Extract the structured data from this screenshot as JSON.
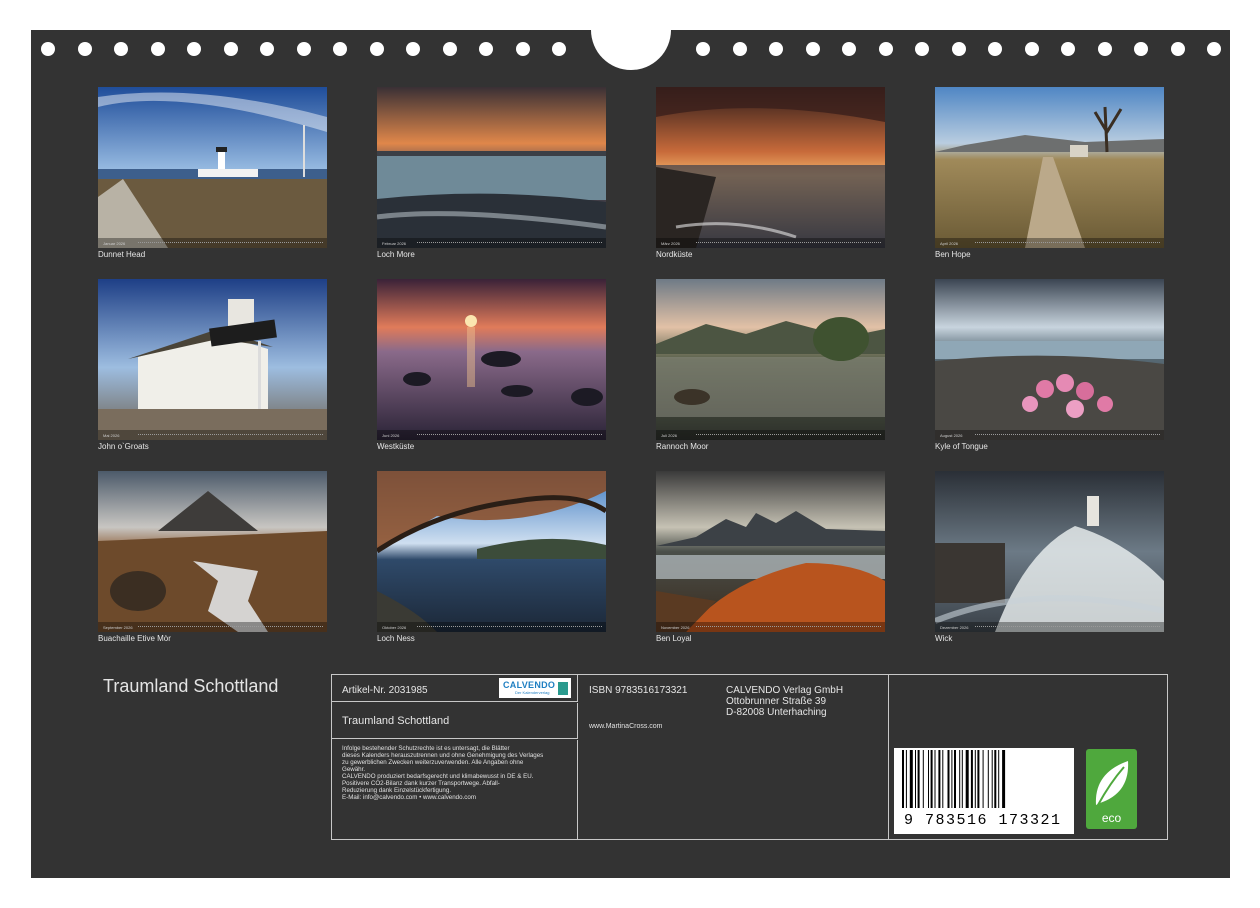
{
  "calendar_title": "Traumland Schottland",
  "months": [
    {
      "month": "Januar 2026",
      "caption": "Dunnet Head"
    },
    {
      "month": "Februar 2026",
      "caption": "Loch More"
    },
    {
      "month": "März 2026",
      "caption": "Nordküste"
    },
    {
      "month": "April 2026",
      "caption": "Ben Hope"
    },
    {
      "month": "Mai 2026",
      "caption": "John o`Groats"
    },
    {
      "month": "Juni 2026",
      "caption": "Westküste"
    },
    {
      "month": "Juli 2026",
      "caption": "Rannoch Moor"
    },
    {
      "month": "August 2026",
      "caption": "Kyle of Tongue"
    },
    {
      "month": "September 2026",
      "caption": "Buachaille Etive Mòr"
    },
    {
      "month": "Oktober 2026",
      "caption": "Loch Ness"
    },
    {
      "month": "November 2026",
      "caption": "Ben Loyal"
    },
    {
      "month": "Dezember 2026",
      "caption": "Wick"
    }
  ],
  "info": {
    "article": "Artikel-Nr. 2031985",
    "logo_text": "CALVENDO",
    "logo_sub": "Der Kalenderverlag",
    "title": "Traumland Schottland",
    "legal_lines": [
      "Infolge bestehender Schutzrechte ist es untersagt, die Blätter",
      "dieses Kalenders herauszutrennen und ohne Genehmigung des Verlages",
      "zu gewerblichen Zwecken weiterzuverwenden. Alle Angaben ohne",
      "Gewähr.",
      "CALVENDO produziert bedarfsgerecht und klimabewusst in DE & EU.",
      "Positivere CO2-Bilanz dank kurzer Transportwege. Abfall-",
      "Reduzierung dank Einzelstückfertigung.",
      "E-Mail: info@calvendo.com • www.calvendo.com"
    ],
    "isbn": "ISBN 9783516173321",
    "publisher": [
      "CALVENDO Verlag GmbH",
      "Ottobrunner Straße 39",
      "D-82008 Unterhaching"
    ],
    "website": "www.MartinaCross.com",
    "barcode_number": "9 783516 173321",
    "eco_label": "eco"
  }
}
